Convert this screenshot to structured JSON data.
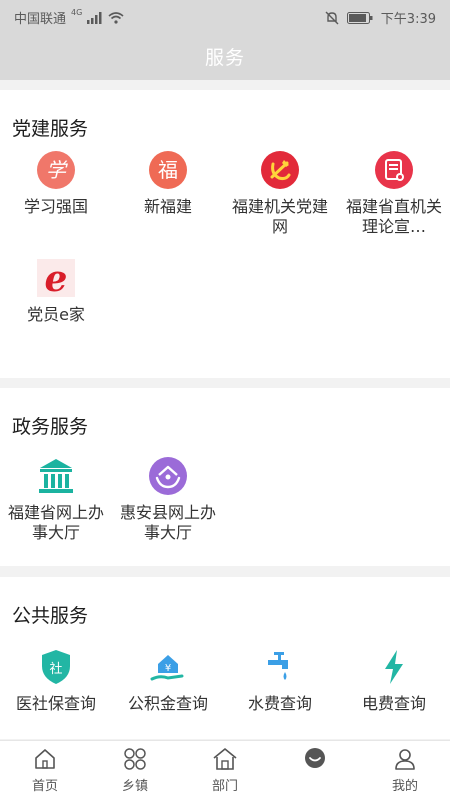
{
  "status": {
    "carrier": "中国联通",
    "network": "4G",
    "time": "下午3:39"
  },
  "header": {
    "title": "服务"
  },
  "sections": [
    {
      "title": "党建服务",
      "items": [
        {
          "label": "学习强国",
          "icon": "xuexi-logo-icon"
        },
        {
          "label": "新福建",
          "icon": "fu-character-icon"
        },
        {
          "label": "福建机关党建网",
          "icon": "party-emblem-icon"
        },
        {
          "label": "福建省直机关理论宣…",
          "icon": "document-icon"
        },
        {
          "label": "党员e家",
          "icon": "e-logo-icon"
        }
      ]
    },
    {
      "title": "政务服务",
      "items": [
        {
          "label": "福建省网上办事大厅",
          "icon": "government-building-icon"
        },
        {
          "label": "惠安县网上办事大厅",
          "icon": "house-hands-icon"
        }
      ]
    },
    {
      "title": "公共服务",
      "items": [
        {
          "label": "医社保查询",
          "icon": "shield-she-icon"
        },
        {
          "label": "公积金查询",
          "icon": "house-hand-yuan-icon"
        },
        {
          "label": "水费查询",
          "icon": "faucet-icon"
        },
        {
          "label": "电费查询",
          "icon": "lightning-icon"
        }
      ]
    }
  ],
  "tabbar": [
    {
      "label": "首页",
      "icon": "home-icon"
    },
    {
      "label": "乡镇",
      "icon": "grid-circles-icon"
    },
    {
      "label": "部门",
      "icon": "house-outline-icon"
    },
    {
      "label": "",
      "icon": "chat-bubble-icon"
    },
    {
      "label": "我的",
      "icon": "user-icon"
    }
  ],
  "colors": {
    "header_bg": "#d9d9d9",
    "party_red": "#e8463c",
    "gov_teal": "#1bb3a0",
    "purple": "#9b6bd8",
    "public_teal": "#22b6a4",
    "water_blue": "#3b9fe6"
  }
}
